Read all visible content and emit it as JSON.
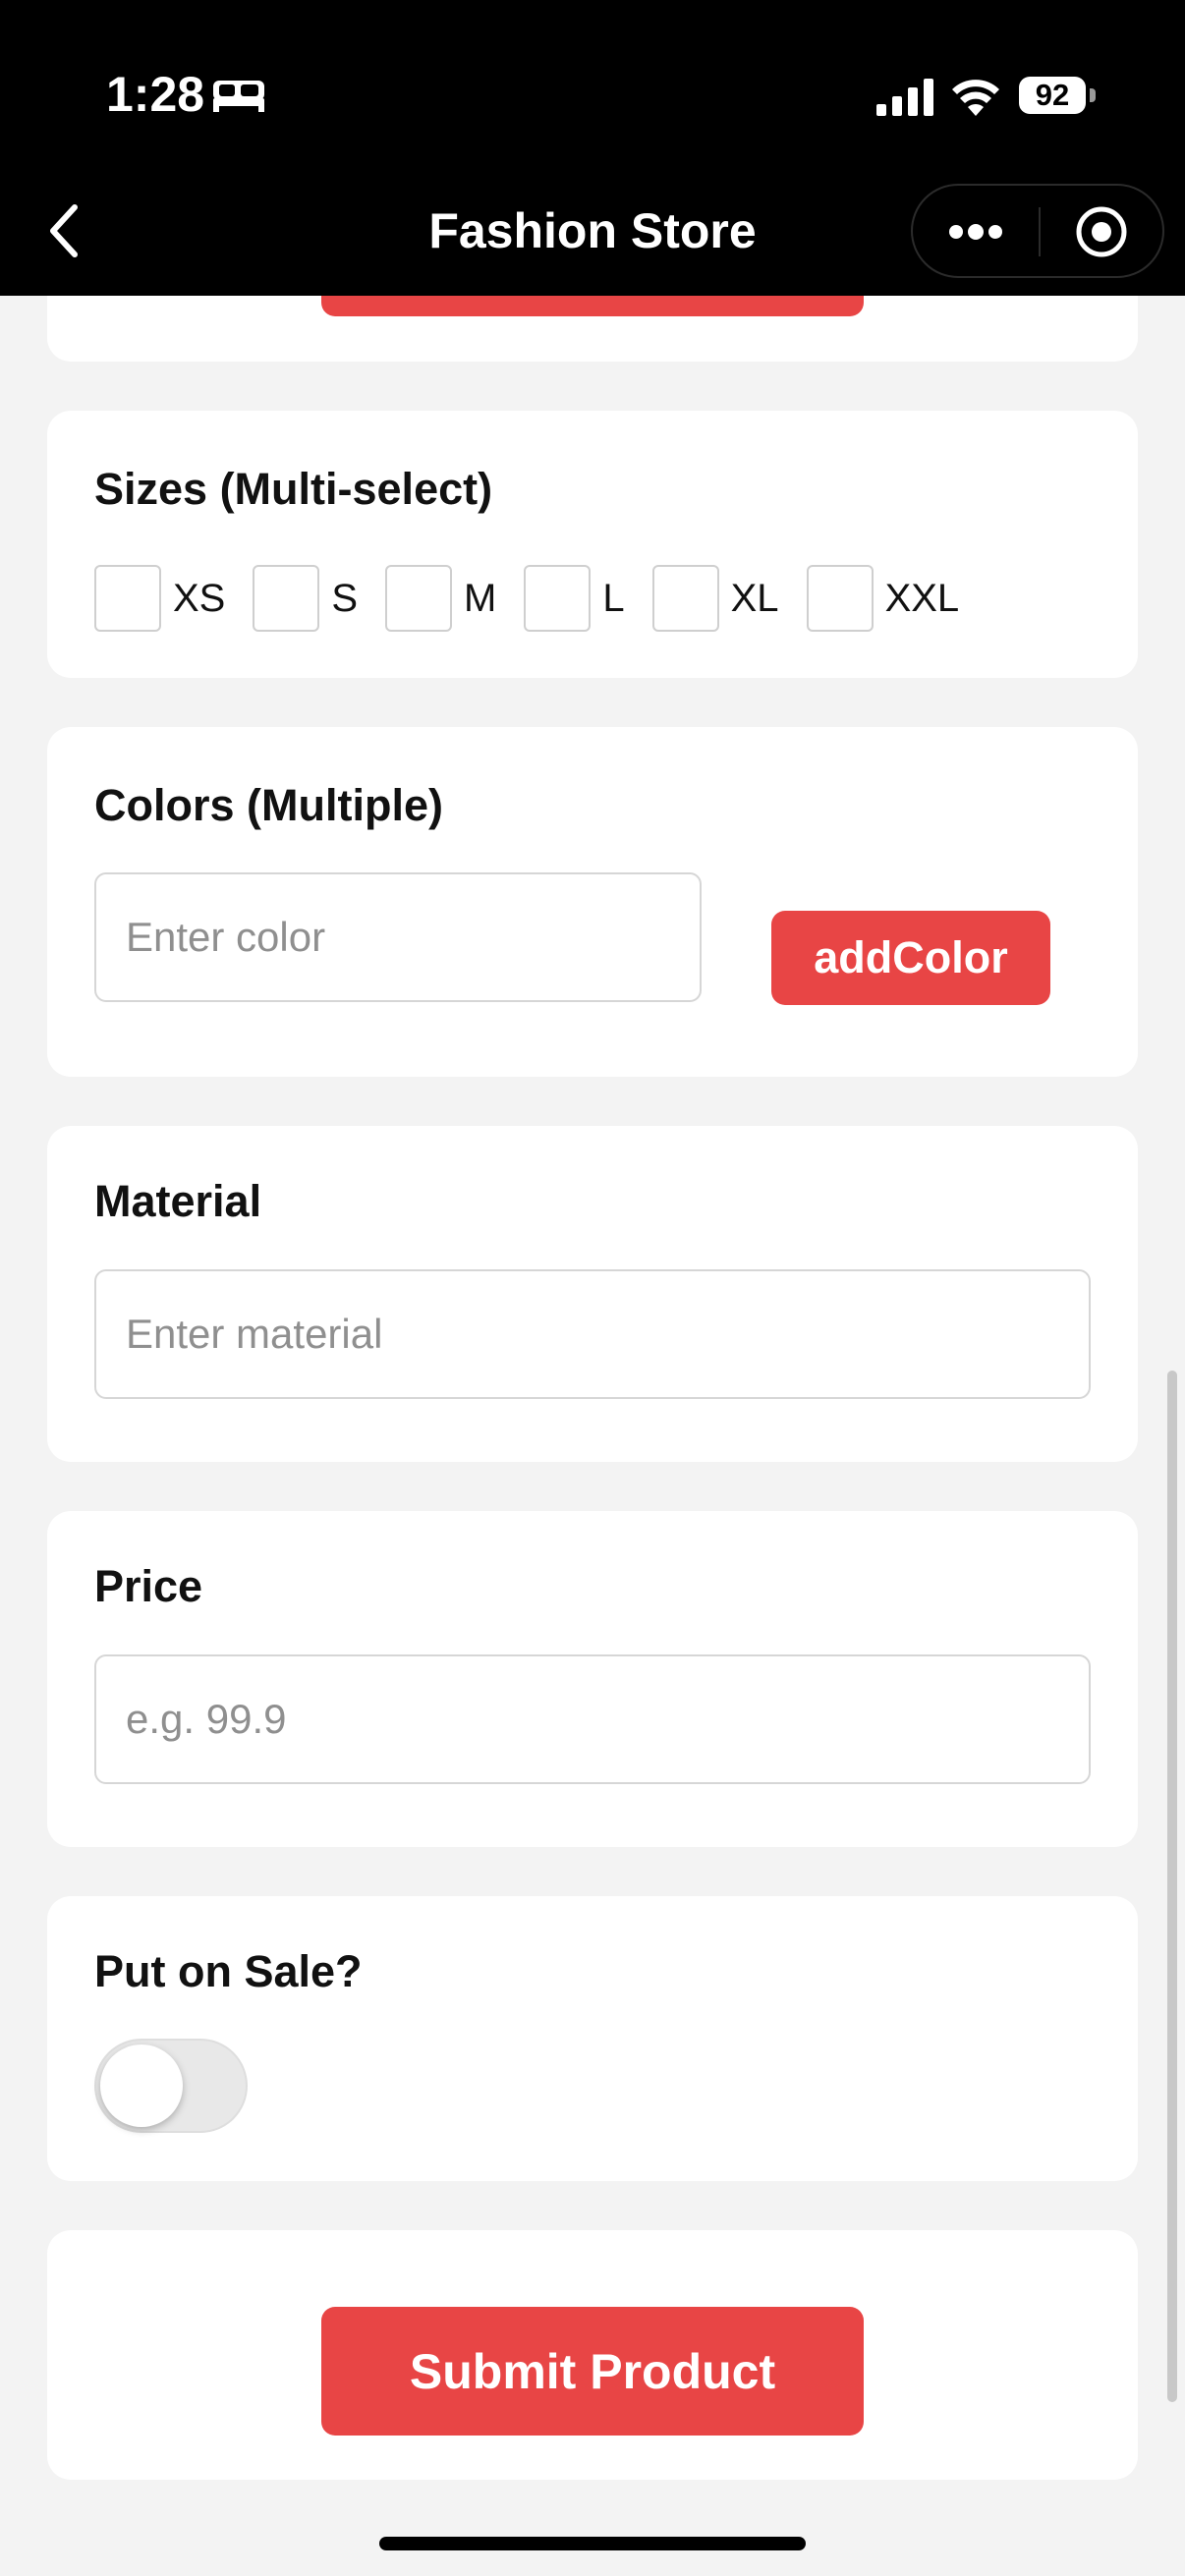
{
  "status_bar": {
    "time": "1:28",
    "battery": "92"
  },
  "nav": {
    "title": "Fashion Store"
  },
  "sizes": {
    "label": "Sizes (Multi-select)",
    "options": [
      "XS",
      "S",
      "M",
      "L",
      "XL",
      "XXL"
    ]
  },
  "colors": {
    "label": "Colors (Multiple)",
    "placeholder": "Enter color",
    "add_button": "addColor"
  },
  "material": {
    "label": "Material",
    "placeholder": "Enter material"
  },
  "price": {
    "label": "Price",
    "placeholder": "e.g. 99.9"
  },
  "sale": {
    "label": "Put on Sale?",
    "enabled": false
  },
  "submit": {
    "label": "Submit Product"
  },
  "theme": {
    "accent": "#e84545",
    "background": "#f3f3f3"
  }
}
